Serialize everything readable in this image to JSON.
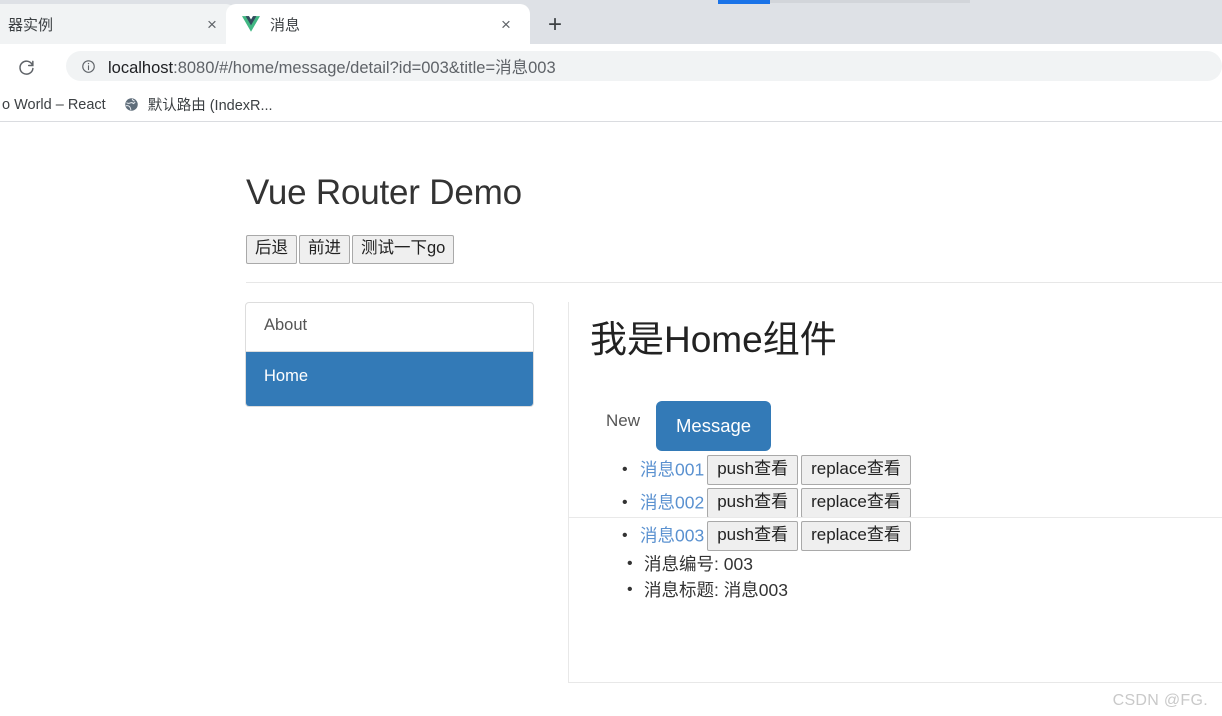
{
  "browser": {
    "progress_accent": "#1a73e8",
    "tabs": [
      {
        "title": "器实例",
        "favicon": "none",
        "close_label": "×",
        "active": false
      },
      {
        "title": "消息",
        "favicon": "vue-logo-icon",
        "close_label": "×",
        "active": true
      }
    ],
    "new_tab_label": "+",
    "reload_icon": "reload-icon",
    "omnibox": {
      "info_icon": "info-circle-icon",
      "url_host": "localhost",
      "url_rest": ":8080/#/home/message/detail?id=003&title=消息003",
      "full_url": "localhost:8080/#/home/message/detail?id=003&title=消息003"
    },
    "bookmarks": [
      {
        "label": "o World – React",
        "favicon": "none"
      },
      {
        "label": "默认路由 (IndexR...",
        "favicon": "globe-icon"
      }
    ]
  },
  "app": {
    "title": "Vue Router Demo",
    "nav_buttons": [
      {
        "label": "后退"
      },
      {
        "label": "前进"
      },
      {
        "label": "测试一下go"
      }
    ],
    "sidebar": {
      "items": [
        {
          "label": "About",
          "active": false
        },
        {
          "label": "Home",
          "active": true
        }
      ]
    },
    "main": {
      "heading": "我是Home组件",
      "tabs": [
        {
          "label": "New",
          "active": false
        },
        {
          "label": "Message",
          "active": true
        }
      ],
      "messages": [
        {
          "link": "消息001",
          "push_label": "push查看",
          "replace_label": "replace查看"
        },
        {
          "link": "消息002",
          "push_label": "push查看",
          "replace_label": "replace查看"
        },
        {
          "link": "消息003",
          "push_label": "push查看",
          "replace_label": "replace查看"
        }
      ],
      "detail": [
        {
          "text": "消息编号: 003"
        },
        {
          "text": "消息标题: 消息003"
        }
      ]
    },
    "accent_color": "#337ab7",
    "link_color": "#5a91d0"
  },
  "watermark": {
    "text": "CSDN @FG."
  }
}
